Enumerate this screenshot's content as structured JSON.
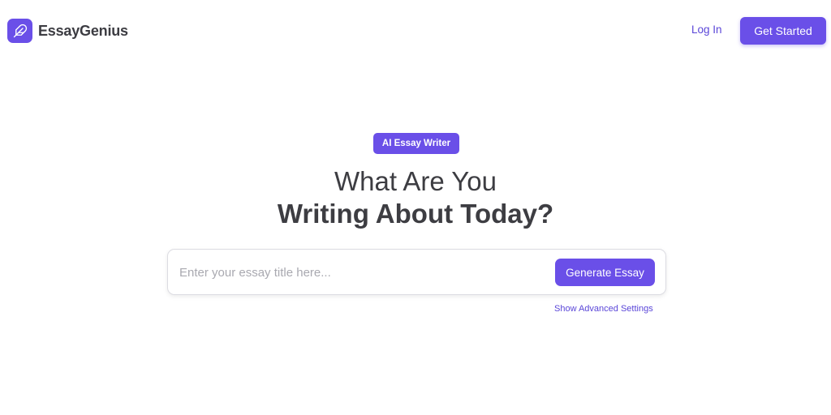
{
  "header": {
    "brand_name": "EssayGenius",
    "logo_icon": "feather-icon",
    "login_label": "Log In",
    "get_started_label": "Get Started"
  },
  "hero": {
    "badge_label": "AI Essay Writer",
    "headline_line1": "What Are You",
    "headline_line2": "Writing About Today?"
  },
  "essay_form": {
    "input_value": "",
    "input_placeholder": "Enter your essay title here...",
    "generate_label": "Generate Essay",
    "advanced_settings_label": "Show Advanced Settings"
  },
  "colors": {
    "accent": "#6a4fe8",
    "link": "#5a46d8",
    "text": "#3d3d42",
    "placeholder": "#a9a9b0"
  }
}
